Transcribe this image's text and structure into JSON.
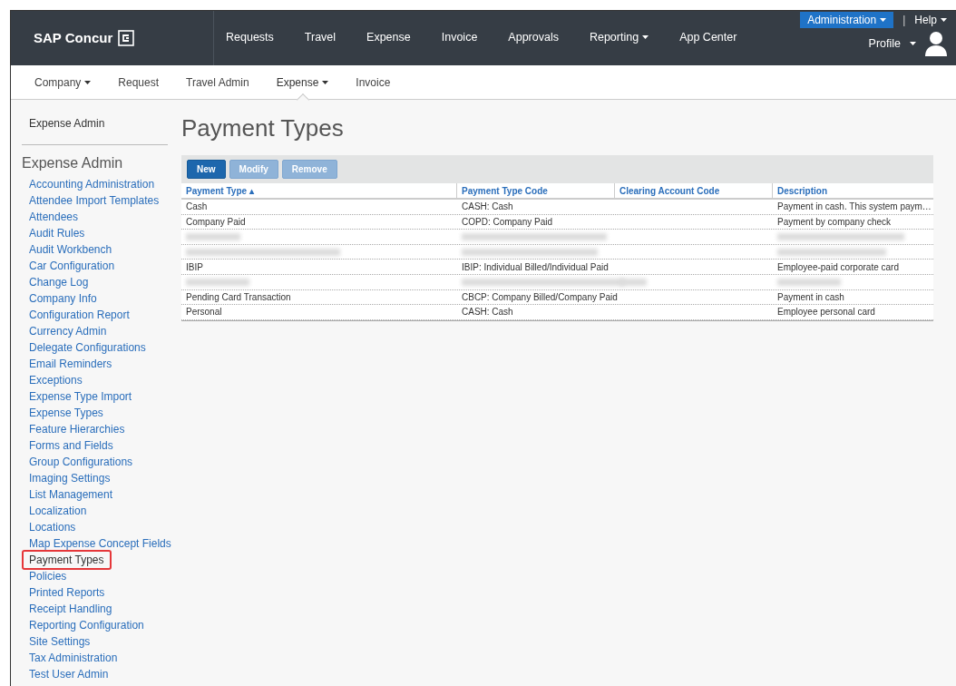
{
  "header": {
    "logo": "SAP Concur",
    "nav": [
      {
        "label": "Requests",
        "dropdown": false
      },
      {
        "label": "Travel",
        "dropdown": false
      },
      {
        "label": "Expense",
        "dropdown": false
      },
      {
        "label": "Invoice",
        "dropdown": false
      },
      {
        "label": "Approvals",
        "dropdown": false
      },
      {
        "label": "Reporting",
        "dropdown": true
      },
      {
        "label": "App Center",
        "dropdown": false
      }
    ],
    "admin_button": "Administration",
    "separator": "|",
    "help": "Help",
    "profile": "Profile"
  },
  "subnav": [
    {
      "label": "Company",
      "dropdown": true,
      "selected": false
    },
    {
      "label": "Request",
      "dropdown": false,
      "selected": false
    },
    {
      "label": "Travel Admin",
      "dropdown": false,
      "selected": false
    },
    {
      "label": "Expense",
      "dropdown": true,
      "selected": true
    },
    {
      "label": "Invoice",
      "dropdown": false,
      "selected": false
    }
  ],
  "sidebar": {
    "top_link": "Expense Admin",
    "heading": "Expense Admin",
    "items": [
      {
        "label": "Accounting Administration",
        "selected": false
      },
      {
        "label": "Attendee Import Templates",
        "selected": false
      },
      {
        "label": "Attendees",
        "selected": false
      },
      {
        "label": "Audit Rules",
        "selected": false
      },
      {
        "label": "Audit Workbench",
        "selected": false
      },
      {
        "label": "Car Configuration",
        "selected": false
      },
      {
        "label": "Change Log",
        "selected": false
      },
      {
        "label": "Company Info",
        "selected": false
      },
      {
        "label": "Configuration Report",
        "selected": false
      },
      {
        "label": "Currency Admin",
        "selected": false
      },
      {
        "label": "Delegate Configurations",
        "selected": false
      },
      {
        "label": "Email Reminders",
        "selected": false
      },
      {
        "label": "Exceptions",
        "selected": false
      },
      {
        "label": "Expense Type Import",
        "selected": false
      },
      {
        "label": "Expense Types",
        "selected": false
      },
      {
        "label": "Feature Hierarchies",
        "selected": false
      },
      {
        "label": "Forms and Fields",
        "selected": false
      },
      {
        "label": "Group Configurations",
        "selected": false
      },
      {
        "label": "Imaging Settings",
        "selected": false
      },
      {
        "label": "List Management",
        "selected": false
      },
      {
        "label": "Localization",
        "selected": false
      },
      {
        "label": "Locations",
        "selected": false
      },
      {
        "label": "Map Expense Concept Fields",
        "selected": false
      },
      {
        "label": "Payment Types",
        "selected": true
      },
      {
        "label": "Policies",
        "selected": false
      },
      {
        "label": "Printed Reports",
        "selected": false
      },
      {
        "label": "Receipt Handling",
        "selected": false
      },
      {
        "label": "Reporting Configuration",
        "selected": false
      },
      {
        "label": "Site Settings",
        "selected": false
      },
      {
        "label": "Tax Administration",
        "selected": false
      },
      {
        "label": "Test User Admin",
        "selected": false
      }
    ]
  },
  "page_title": "Payment Types",
  "toolbar": [
    {
      "label": "New",
      "disabled": false
    },
    {
      "label": "Modify",
      "disabled": true
    },
    {
      "label": "Remove",
      "disabled": true
    }
  ],
  "table": {
    "columns": [
      "Payment Type ▴",
      "Payment Type Code",
      "Clearing Account Code",
      "Description"
    ],
    "rows": [
      {
        "kind": "text",
        "cells": [
          "Cash",
          "CASH: Cash",
          "",
          "Payment in cash. This system paym…"
        ]
      },
      {
        "kind": "text",
        "cells": [
          "Company Paid",
          "COPD: Company Paid",
          "",
          "Payment by company check"
        ]
      },
      {
        "kind": "redacted"
      },
      {
        "kind": "redacted"
      },
      {
        "kind": "text",
        "cells": [
          "IBIP",
          "IBIP: Individual Billed/Individual Paid",
          "",
          "Employee-paid corporate card"
        ]
      },
      {
        "kind": "redacted"
      },
      {
        "kind": "text",
        "cells": [
          "Pending Card Transaction",
          "CBCP: Company Billed/Company Paid",
          "",
          "Payment in cash"
        ]
      },
      {
        "kind": "text",
        "cells": [
          "Personal",
          "CASH: Cash",
          "",
          "Employee personal card"
        ]
      }
    ]
  }
}
